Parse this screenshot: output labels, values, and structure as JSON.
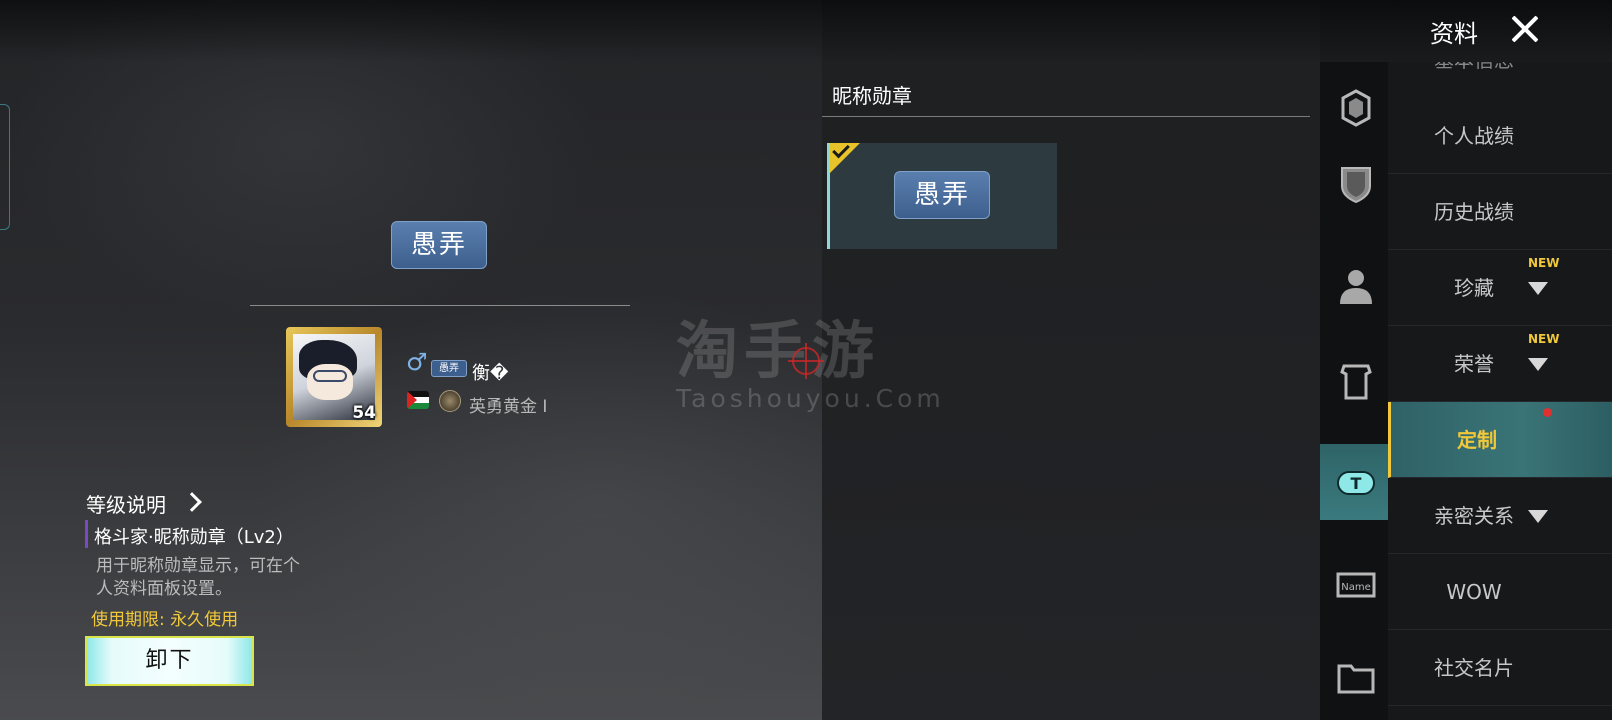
{
  "header": {
    "title": "资料"
  },
  "preview": {
    "badge_text": "愚弄",
    "player": {
      "avatar_level": "54",
      "gender_symbol": "♂",
      "mini_badge": "愚弄",
      "name": "衡�",
      "rank": "英勇黄金 I"
    }
  },
  "item_info": {
    "level_title": "等级说明",
    "name": "格斗家·昵称勋章（Lv2）",
    "description": "用于昵称勋章显示，可在个人资料面板设置。",
    "expiry": "使用期限: 永久使用",
    "unequip_label": "卸下"
  },
  "watermark": {
    "cn": "淘手游",
    "en": "Taoshouyou.Com"
  },
  "section": {
    "title": "昵称勋章",
    "cards": [
      {
        "badge_text": "愚弄",
        "equipped": true
      }
    ]
  },
  "sidebar": {
    "partial_item": "基本信息",
    "items": [
      {
        "label": "个人战绩"
      },
      {
        "label": "历史战绩"
      },
      {
        "label": "珍藏",
        "tag": "NEW",
        "has_arrow": true
      },
      {
        "label": "荣誉",
        "tag": "NEW",
        "has_arrow": true
      },
      {
        "label": "定制",
        "active": true,
        "has_dot": true
      },
      {
        "label": "亲密关系",
        "has_arrow": true
      },
      {
        "label": "WOW"
      },
      {
        "label": "社交名片"
      }
    ]
  },
  "colors": {
    "accent_gold": "#f0c83a",
    "active_teal": "#3a7477",
    "badge_blue": "#3d5f8e"
  }
}
